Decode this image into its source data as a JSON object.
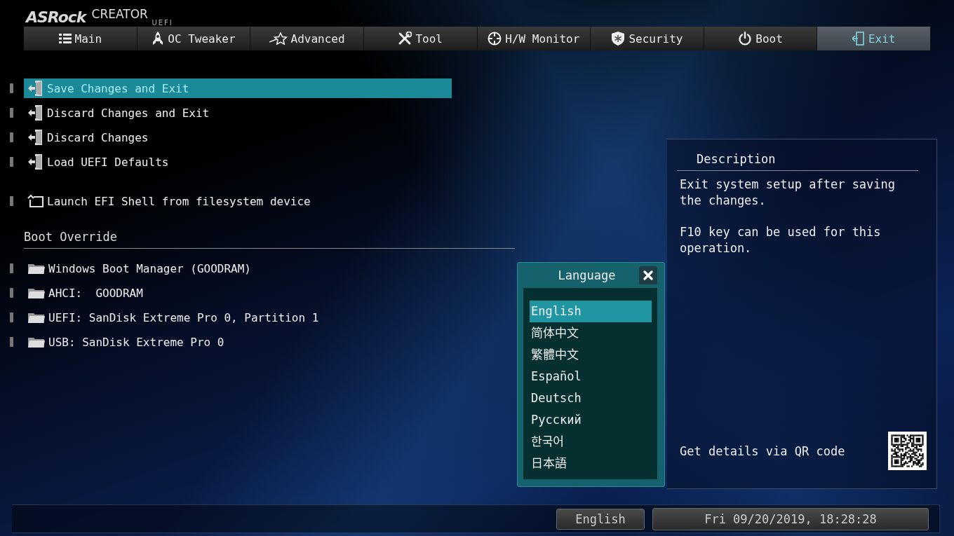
{
  "logo": {
    "brand": "ASRock",
    "series": "CREATOR",
    "firmware": "UEFI"
  },
  "tabs": [
    {
      "label": "Main",
      "selected": false
    },
    {
      "label": "OC Tweaker",
      "selected": false
    },
    {
      "label": "Advanced",
      "selected": false
    },
    {
      "label": "Tool",
      "selected": false
    },
    {
      "label": "H/W Monitor",
      "selected": false
    },
    {
      "label": "Security",
      "selected": false
    },
    {
      "label": "Boot",
      "selected": false
    },
    {
      "label": "Exit",
      "selected": true
    }
  ],
  "exit_menu": {
    "items": [
      {
        "kind": "exit",
        "label": "Save Changes and Exit",
        "selected": true
      },
      {
        "kind": "exit",
        "label": "Discard Changes and Exit",
        "selected": false
      },
      {
        "kind": "exit",
        "label": "Discard Changes",
        "selected": false
      },
      {
        "kind": "exit",
        "label": "Load UEFI Defaults",
        "selected": false
      },
      {
        "kind": "shell",
        "label": "Launch EFI Shell from filesystem device",
        "selected": false
      }
    ]
  },
  "boot_override": {
    "title": "Boot Override",
    "items": [
      {
        "label": "Windows Boot Manager (GOODRAM)",
        "selected": false
      },
      {
        "label": "AHCI:  GOODRAM",
        "selected": false
      },
      {
        "label": "UEFI: SanDisk Extreme Pro 0, Partition 1",
        "selected": false
      },
      {
        "label": "USB: SanDisk Extreme Pro 0",
        "selected": false
      }
    ]
  },
  "description": {
    "title": "Description",
    "paragraphs": [
      "Exit system setup after saving the changes.",
      "F10 key can be used for this operation."
    ],
    "qr_caption": "Get details via QR code"
  },
  "language_dialog": {
    "title": "Language",
    "options": [
      {
        "label": "English",
        "selected": true
      },
      {
        "label": "简体中文",
        "selected": false
      },
      {
        "label": "繁體中文",
        "selected": false
      },
      {
        "label": "Español",
        "selected": false
      },
      {
        "label": "Deutsch",
        "selected": false
      },
      {
        "label": "Русский",
        "selected": false
      },
      {
        "label": "한국어",
        "selected": false
      },
      {
        "label": "日本語",
        "selected": false
      }
    ]
  },
  "status_bar": {
    "language": "English",
    "datetime": "Fri 09/20/2019, 18:28:28"
  }
}
